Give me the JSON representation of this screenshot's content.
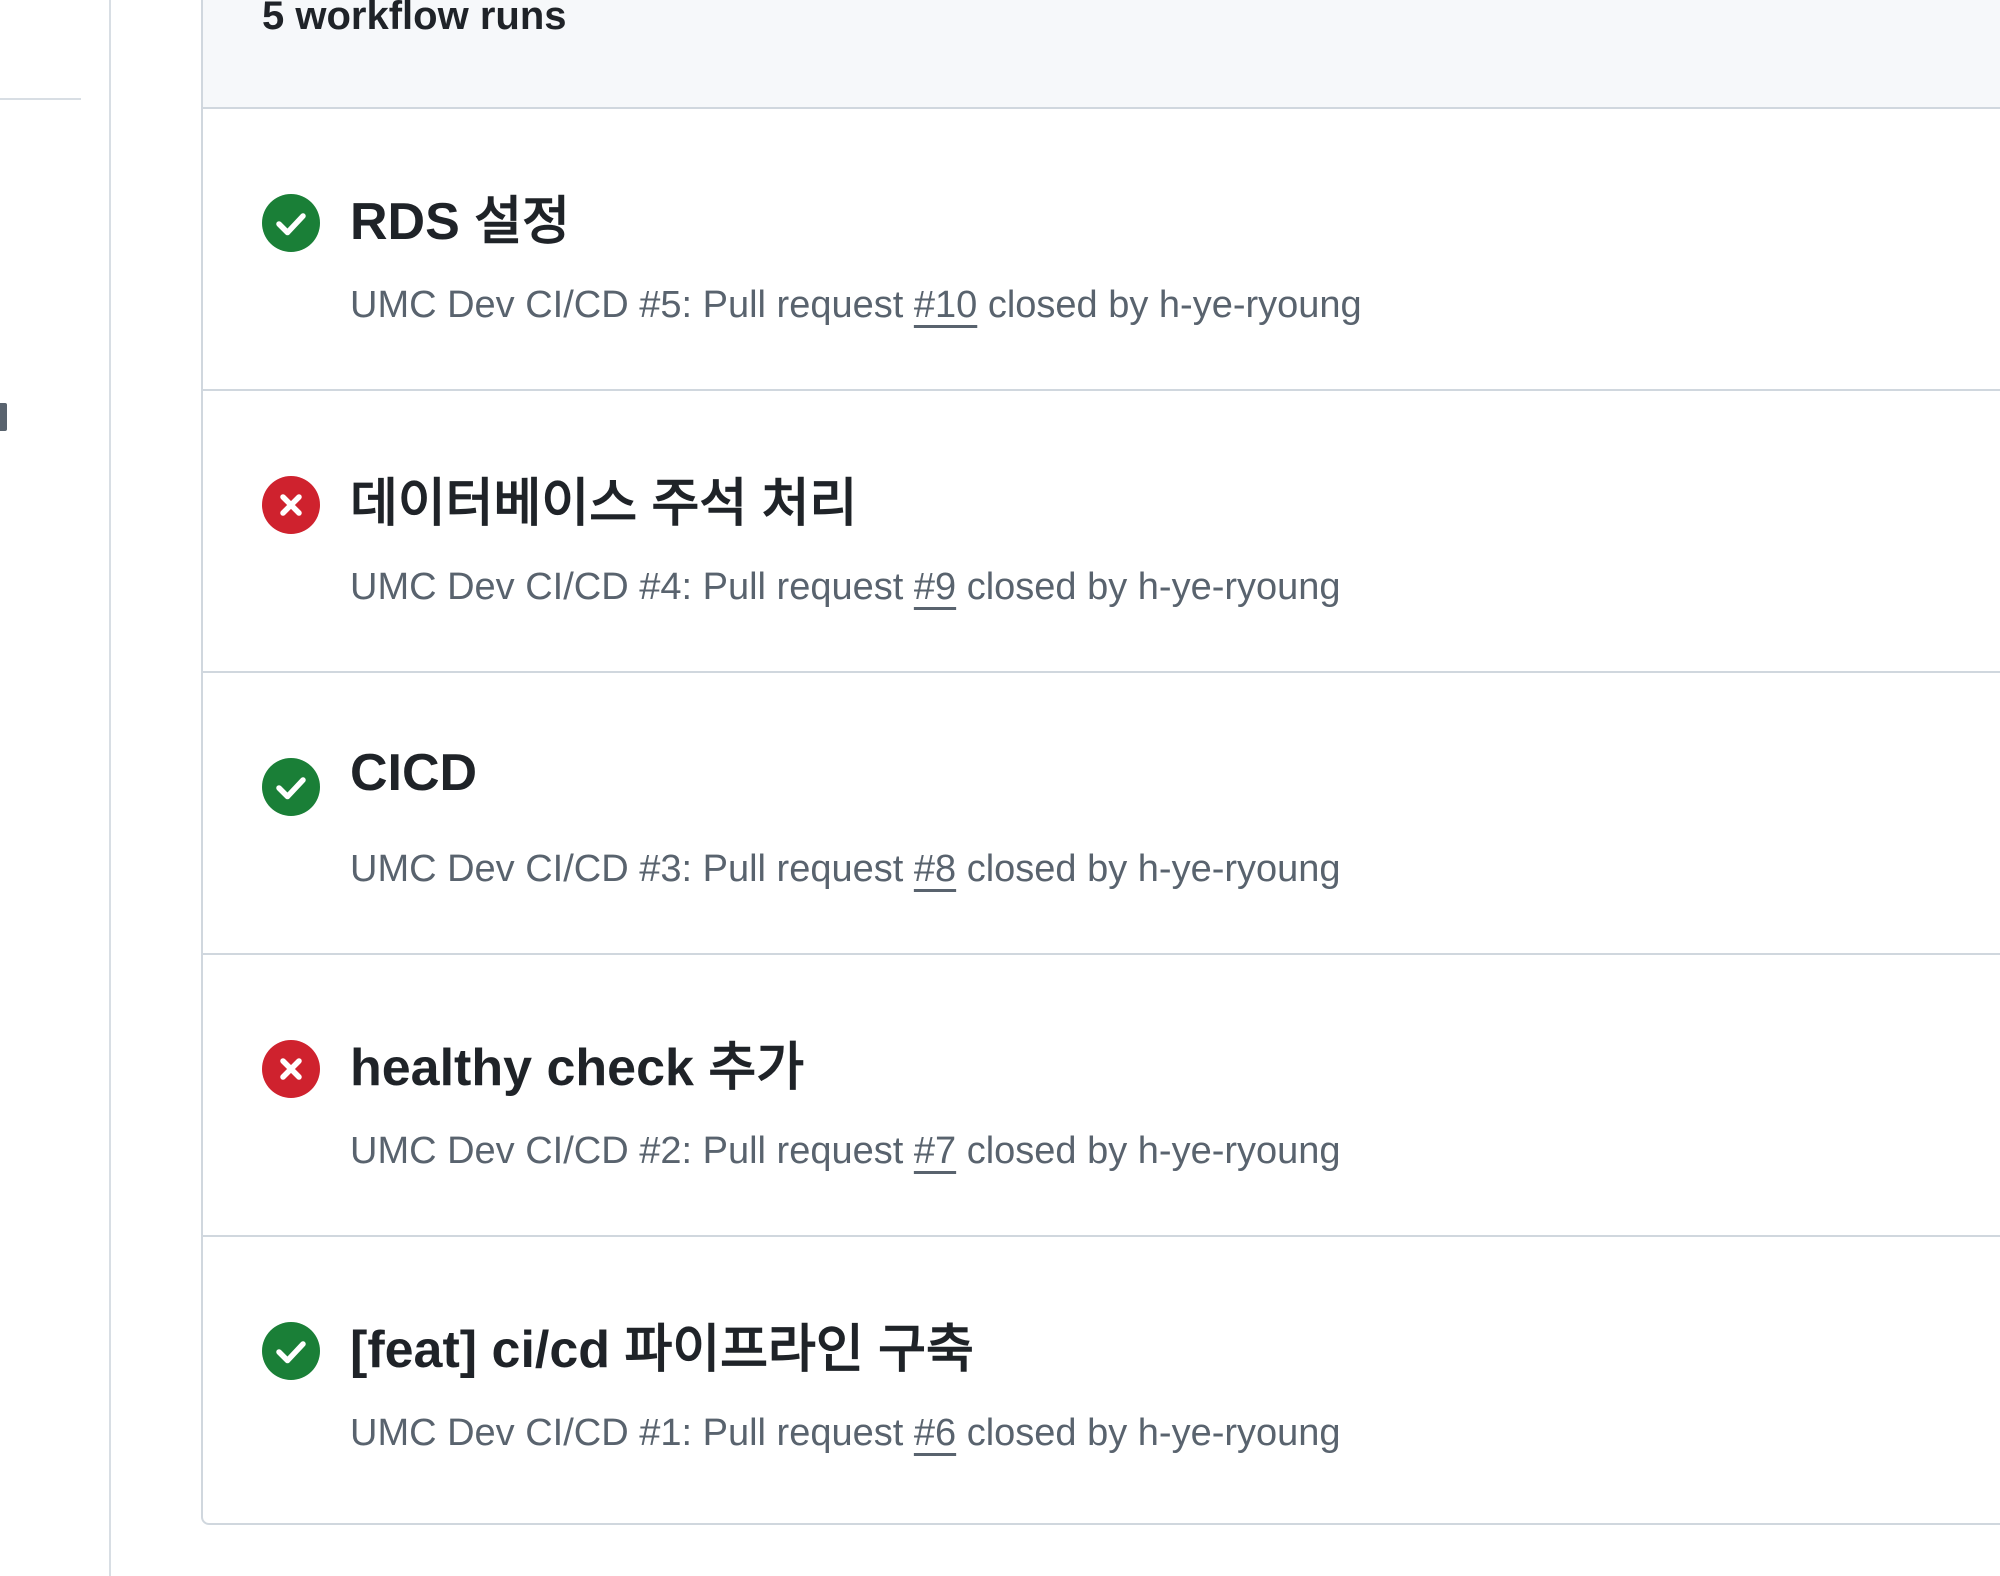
{
  "runs_header": {
    "count_label": "5 workflow runs"
  },
  "colors": {
    "success": "#1a7f37",
    "failure": "#cf222e",
    "muted": "#59636e",
    "border": "#d0d7de"
  },
  "runs": [
    {
      "status": "success",
      "status_icon": "check-circle-icon",
      "title": "RDS 설정",
      "workflow": "UMC Dev CI/CD #5: Pull request",
      "pr": "#10",
      "closed_by": "closed by h-ye-ryoung"
    },
    {
      "status": "failure",
      "status_icon": "x-circle-icon",
      "title": "데이터베이스 주석 처리",
      "workflow": "UMC Dev CI/CD #4: Pull request",
      "pr": "#9",
      "closed_by": "closed by h-ye-ryoung"
    },
    {
      "status": "success",
      "status_icon": "check-circle-icon",
      "title": "CICD",
      "workflow": "UMC Dev CI/CD #3: Pull request",
      "pr": "#8",
      "closed_by": "closed by h-ye-ryoung"
    },
    {
      "status": "failure",
      "status_icon": "x-circle-icon",
      "title": "healthy check 추가",
      "workflow": "UMC Dev CI/CD #2: Pull request",
      "pr": "#7",
      "closed_by": "closed by h-ye-ryoung"
    },
    {
      "status": "success",
      "status_icon": "check-circle-icon",
      "title": "[feat] ci/cd 파이프라인 구축",
      "workflow": "UMC Dev CI/CD #1: Pull request",
      "pr": "#6",
      "closed_by": "closed by h-ye-ryoung"
    }
  ]
}
